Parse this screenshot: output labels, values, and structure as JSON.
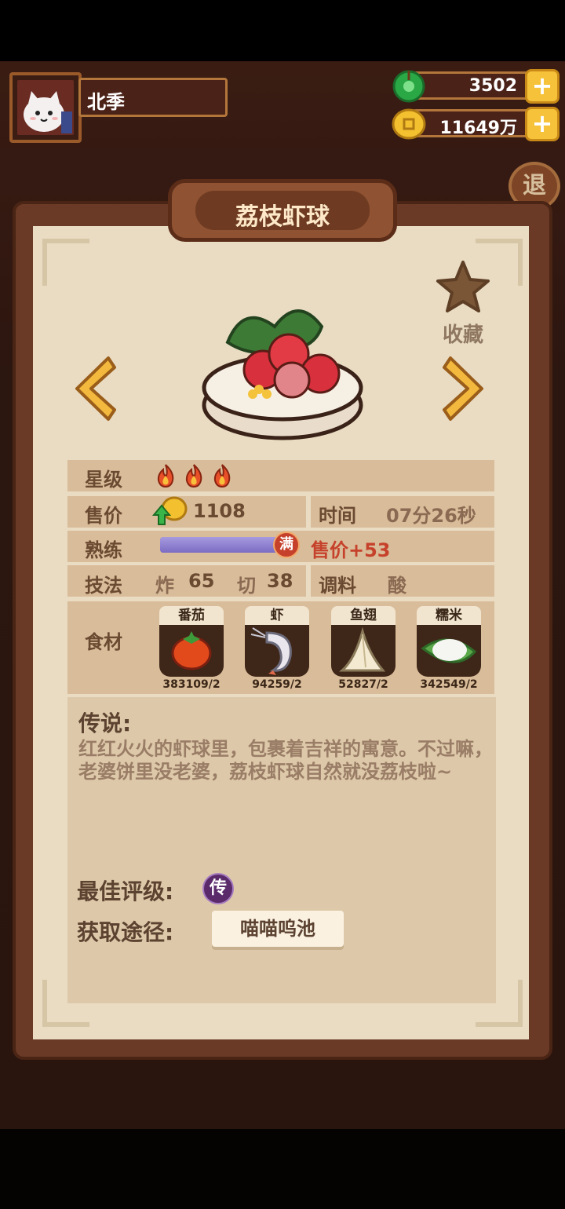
{
  "player": {
    "name": "北季"
  },
  "currencies": {
    "jade": "3502",
    "coins": "11649万"
  },
  "exit_label": "退",
  "dish": {
    "title": "荔枝虾球",
    "favorite_label": "收藏",
    "stars_label": "星级",
    "star_level": 3,
    "price_label": "售价",
    "price": "1108",
    "time_label": "时间",
    "time": "07分26秒",
    "proficiency_label": "熟练",
    "proficiency_fraction": 1.0,
    "proficiency_badge": "满",
    "proficiency_bonus": "售价+53",
    "technique_label": "技法",
    "technique": [
      {
        "name": "炸",
        "value": "65"
      },
      {
        "name": "切",
        "value": "38"
      }
    ],
    "seasoning_label": "调料",
    "seasoning": "酸",
    "ingredients_label": "食材",
    "ingredients": [
      {
        "name": "番茄",
        "count": "383109/2",
        "icon": "tomato-icon"
      },
      {
        "name": "虾",
        "count": "94259/2",
        "icon": "shrimp-icon"
      },
      {
        "name": "鱼翅",
        "count": "52827/2",
        "icon": "shark-fin-icon"
      },
      {
        "name": "糯米",
        "count": "342549/2",
        "icon": "sticky-rice-icon"
      }
    ],
    "legend_title": "传说:",
    "legend_text": "红红火火的虾球里，包裹着吉祥的寓意。不过嘛，老婆饼里没老婆，荔枝虾球自然就没荔枝啦~",
    "best_rating_label": "最佳评级:",
    "best_rating": "传",
    "source_label": "获取途径:",
    "source": "喵喵呜池"
  },
  "colors": {
    "panel_bg": "#e9dcc3",
    "row_bg": "#d9bc99",
    "accent_red": "#c6412b",
    "bar_purple": "#8a77b8",
    "rating_purple": "#5a2a6a"
  }
}
